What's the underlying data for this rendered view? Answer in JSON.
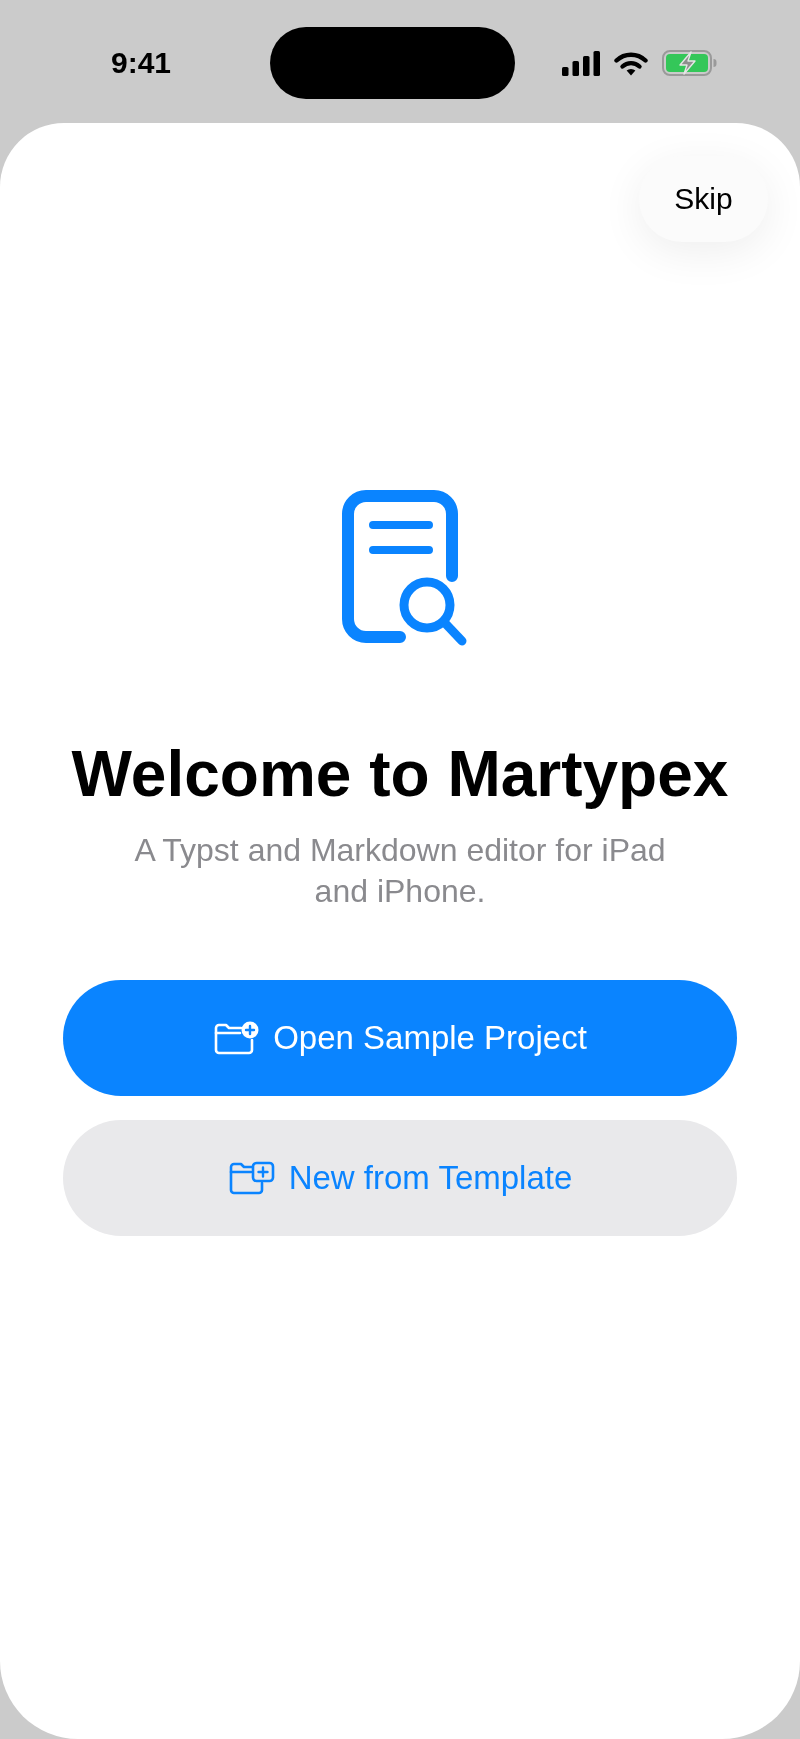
{
  "status_bar": {
    "time": "9:41"
  },
  "skip_button": {
    "label": "Skip"
  },
  "welcome": {
    "title": "Welcome to Martypex",
    "subtitle": "A Typst and Markdown editor for iPad and iPhone."
  },
  "actions": [
    {
      "kind": "primary",
      "label": "Open Sample Project"
    },
    {
      "kind": "secondary",
      "label": "New from Template"
    }
  ]
}
